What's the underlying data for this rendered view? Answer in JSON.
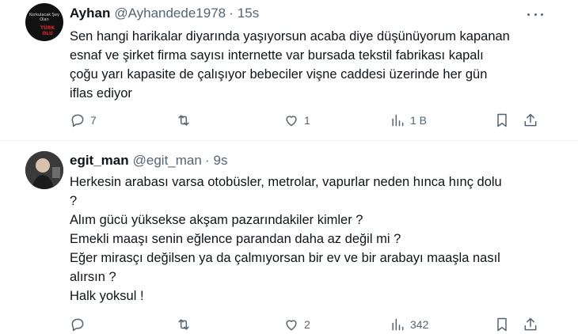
{
  "tweets": [
    {
      "author_name": "Ayhan",
      "handle": "@Ayhandede1978",
      "separator": "·",
      "time": "15s",
      "avatar_text": "Korkulacak Şey Olan",
      "avatar_text2": "TÜRK OLU",
      "lines": [
        "Sen hangi harikalar diyarında yaşıyorsun acaba diye düşünüyorum kapanan",
        "esnaf ve şirket firma sayısı internette var bursada tekstil fabrikası kapalı",
        "çoğu yarı kapasite de çalışıyor bebeciler vişne caddesi üzerinde her gün",
        "iflas ediyor"
      ],
      "replies": "7",
      "reposts": "",
      "likes": "1",
      "views": "1 B"
    },
    {
      "author_name": "egit_man",
      "handle": "@egit_man",
      "separator": "·",
      "time": "9s",
      "lines": [
        "Herkesin arabası varsa otobüsler, metrolar, vapurlar neden hınca hınç dolu",
        "?",
        "Alım gücü yüksekse akşam pazarındakiler kimler ?",
        "Emekli maaşı senin eğlence parandan daha az değil mi ?",
        "Eğer mirasçı değilsen ya da çalmıyorsan bir ev ve bir arabayı maaşla nasıl",
        "alırsın  ?",
        "Halk yoksul !"
      ],
      "replies": "",
      "reposts": "",
      "likes": "2",
      "views": "342"
    }
  ],
  "icons": {
    "reply": "reply-icon",
    "repost": "repost-icon",
    "like": "heart-icon",
    "views": "views-icon",
    "bookmark": "bookmark-icon",
    "share": "share-icon",
    "more": "more-icon"
  }
}
